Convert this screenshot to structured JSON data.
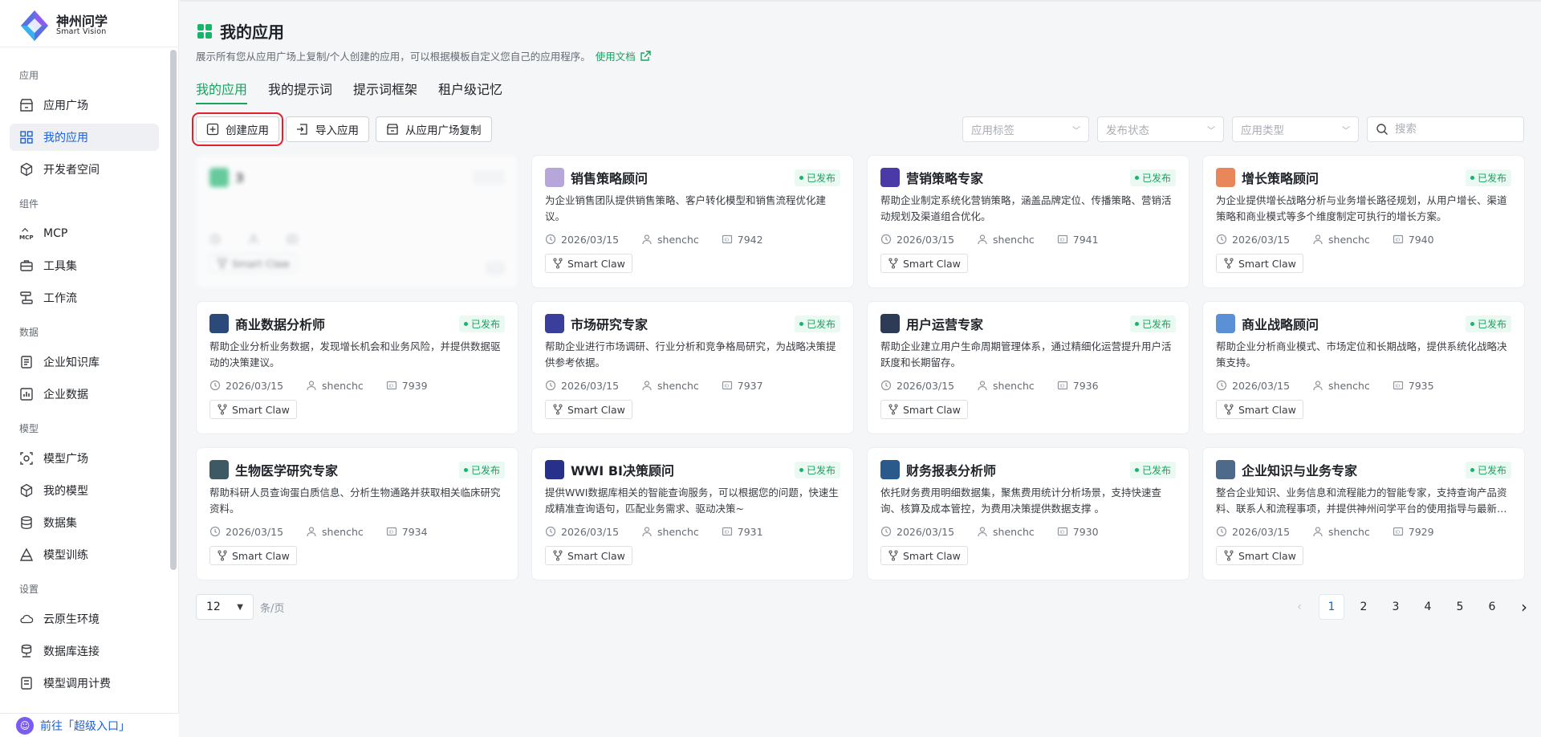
{
  "brand": {
    "name_cn": "神州问学",
    "name_en": "Smart Vision"
  },
  "sidebar": {
    "sections": [
      {
        "title": "应用",
        "items": [
          {
            "label": "应用广场",
            "icon": "store-icon",
            "active": false
          },
          {
            "label": "我的应用",
            "icon": "apps-grid-icon",
            "active": true
          },
          {
            "label": "开发者空间",
            "icon": "cube-icon",
            "active": false
          }
        ]
      },
      {
        "title": "组件",
        "items": [
          {
            "label": "MCP",
            "icon": "mcp-icon",
            "active": false
          },
          {
            "label": "工具集",
            "icon": "toolbox-icon",
            "active": false
          },
          {
            "label": "工作流",
            "icon": "workflow-icon",
            "active": false
          }
        ]
      },
      {
        "title": "数据",
        "items": [
          {
            "label": "企业知识库",
            "icon": "knowledge-base-icon",
            "active": false
          },
          {
            "label": "企业数据",
            "icon": "bar-chart-icon",
            "active": false
          }
        ]
      },
      {
        "title": "模型",
        "items": [
          {
            "label": "模型广场",
            "icon": "model-square-icon",
            "active": false
          },
          {
            "label": "我的模型",
            "icon": "box-icon",
            "active": false
          },
          {
            "label": "数据集",
            "icon": "database-icon",
            "active": false
          },
          {
            "label": "模型训练",
            "icon": "training-icon",
            "active": false
          }
        ]
      },
      {
        "title": "设置",
        "items": [
          {
            "label": "云原生环境",
            "icon": "cloud-icon",
            "active": false
          },
          {
            "label": "数据库连接",
            "icon": "db-connect-icon",
            "active": false
          },
          {
            "label": "模型调用计费",
            "icon": "billing-icon",
            "active": false
          }
        ]
      }
    ],
    "bottom_link": "前往「超级入口」"
  },
  "page": {
    "title": "我的应用",
    "subtitle": "展示所有您从应用广场上复制/个人创建的应用，可以根据模板自定义您自己的应用程序。",
    "doc_link": "使用文档"
  },
  "tabs": [
    {
      "label": "我的应用",
      "active": true
    },
    {
      "label": "我的提示词",
      "active": false
    },
    {
      "label": "提示词框架",
      "active": false
    },
    {
      "label": "租户级记忆",
      "active": false
    }
  ],
  "toolbar": {
    "create_label": "创建应用",
    "import_label": "导入应用",
    "copy_label": "从应用广场复制"
  },
  "filters": {
    "tag_placeholder": "应用标签",
    "status_placeholder": "发布状态",
    "type_placeholder": "应用类型",
    "search_placeholder": "搜索"
  },
  "colors": {
    "accent": "#19a35e",
    "primary": "#1c5fd6",
    "highlight": "#e0202c"
  },
  "cards": [
    {
      "title": "3",
      "status": "",
      "desc": "",
      "date": "",
      "author": "",
      "id": "",
      "tag": "Smart Claw",
      "avatar": "#19b36b",
      "blurred": true
    },
    {
      "title": "销售策略顾问",
      "status": "已发布",
      "desc": "为企业销售团队提供销售策略、客户转化模型和销售流程优化建议。",
      "date": "2026/03/15",
      "author": "shenchc",
      "id": "7942",
      "tag": "Smart Claw",
      "avatar": "#b7a6d9",
      "blurred": false
    },
    {
      "title": "营销策略专家",
      "status": "已发布",
      "desc": "帮助企业制定系统化营销策略，涵盖品牌定位、传播策略、营销活动规划及渠道组合优化。",
      "date": "2026/03/15",
      "author": "shenchc",
      "id": "7941",
      "tag": "Smart Claw",
      "avatar": "#4a3aa8",
      "blurred": false
    },
    {
      "title": "增长策略顾问",
      "status": "已发布",
      "desc": "为企业提供增长战略分析与业务增长路径规划，从用户增长、渠道策略和商业模式等多个维度制定可执行的增长方案。",
      "date": "2026/03/15",
      "author": "shenchc",
      "id": "7940",
      "tag": "Smart Claw",
      "avatar": "#e8885a",
      "blurred": false
    },
    {
      "title": "商业数据分析师",
      "status": "已发布",
      "desc": "帮助企业分析业务数据，发现增长机会和业务风险，并提供数据驱动的决策建议。",
      "date": "2026/03/15",
      "author": "shenchc",
      "id": "7939",
      "tag": "Smart Claw",
      "avatar": "#2b4a7a",
      "blurred": false
    },
    {
      "title": "市场研究专家",
      "status": "已发布",
      "desc": "帮助企业进行市场调研、行业分析和竞争格局研究，为战略决策提供参考依据。",
      "date": "2026/03/15",
      "author": "shenchc",
      "id": "7937",
      "tag": "Smart Claw",
      "avatar": "#3a3f9c",
      "blurred": false
    },
    {
      "title": "用户运营专家",
      "status": "已发布",
      "desc": "帮助企业建立用户生命周期管理体系，通过精细化运营提升用户活跃度和长期留存。",
      "date": "2026/03/15",
      "author": "shenchc",
      "id": "7936",
      "tag": "Smart Claw",
      "avatar": "#2d3b57",
      "blurred": false
    },
    {
      "title": "商业战略顾问",
      "status": "已发布",
      "desc": "帮助企业分析商业模式、市场定位和长期战略，提供系统化战略决策支持。",
      "date": "2026/03/15",
      "author": "shenchc",
      "id": "7935",
      "tag": "Smart Claw",
      "avatar": "#5b8fd6",
      "blurred": false
    },
    {
      "title": "生物医学研究专家",
      "status": "已发布",
      "desc": "帮助科研人员查询蛋白质信息、分析生物通路并获取相关临床研究资料。",
      "date": "2026/03/15",
      "author": "shenchc",
      "id": "7934",
      "tag": "Smart Claw",
      "avatar": "#3d5a64",
      "blurred": false
    },
    {
      "title": "WWI BI决策顾问",
      "status": "已发布",
      "desc": "提供WWI数据库相关的智能查询服务，可以根据您的问题，快速生成精准查询语句，匹配业务需求、驱动决策~",
      "date": "2026/03/15",
      "author": "shenchc",
      "id": "7931",
      "tag": "Smart Claw",
      "avatar": "#27308a",
      "blurred": false
    },
    {
      "title": "财务报表分析师",
      "status": "已发布",
      "desc": "依托财务费用明细数据集，聚焦费用统计分析场景，支持快速查询、核算及成本管控，为费用决策提供数据支撑 。",
      "date": "2026/03/15",
      "author": "shenchc",
      "id": "7930",
      "tag": "Smart Claw",
      "avatar": "#2a5a8c",
      "blurred": false
    },
    {
      "title": "企业知识与业务专家",
      "status": "已发布",
      "desc": "整合企业知识、业务信息和流程能力的智能专家，支持查询产品资料、联系人和流程事项，并提供神州问学平台的使用指导与最新动态。",
      "date": "2026/03/15",
      "author": "shenchc",
      "id": "7929",
      "tag": "Smart Claw",
      "avatar": "#4d6a8a",
      "blurred": false
    }
  ],
  "pagination": {
    "page_size": "12",
    "per_page_label": "条/页",
    "pages": [
      "1",
      "2",
      "3",
      "4",
      "5",
      "6"
    ],
    "current": "1"
  }
}
